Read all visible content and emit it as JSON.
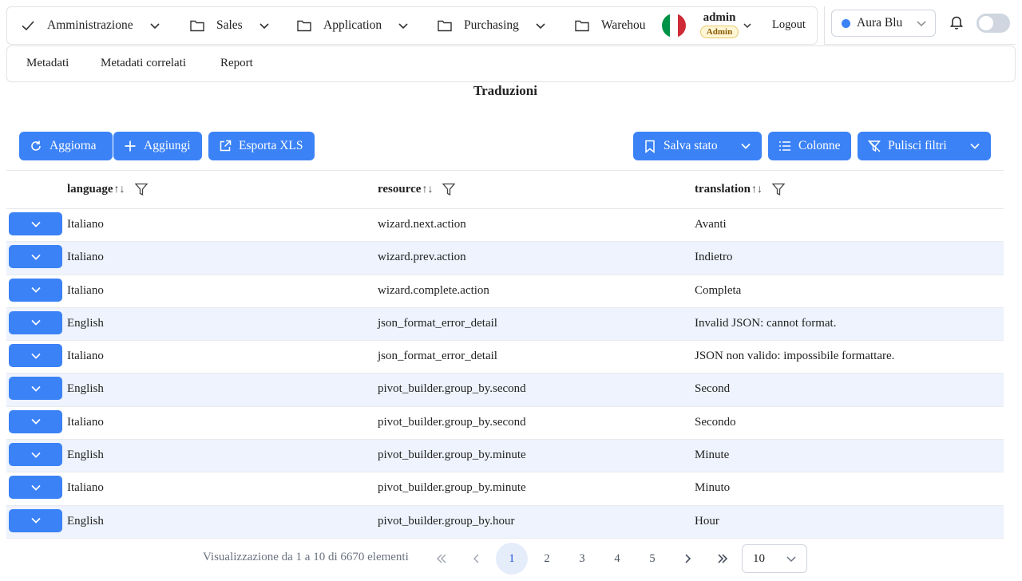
{
  "nav": {
    "items": [
      {
        "label": "Amministrazione",
        "icon": "check-icon"
      },
      {
        "label": "Sales",
        "icon": "folder-icon"
      },
      {
        "label": "Application",
        "icon": "folder-icon"
      },
      {
        "label": "Purchasing",
        "icon": "folder-icon"
      },
      {
        "label": "Warehou",
        "icon": "folder-icon"
      }
    ],
    "user_name": "admin",
    "user_role": "Admin",
    "logout_label": "Logout",
    "flag_colors": [
      "#009246",
      "#ffffff",
      "#ce2b37"
    ]
  },
  "theme": {
    "label": "Aura Blu",
    "dot_color": "#3b82f6"
  },
  "subnav": {
    "items": [
      "Metadati",
      "Metadati correlati",
      "Report"
    ]
  },
  "page_title": "Traduzioni",
  "toolbar": {
    "refresh_label": "Aggiorna",
    "add_label": "Aggiungi",
    "export_label": "Esporta XLS",
    "save_state_label": "Salva stato",
    "columns_label": "Colonne",
    "clear_filters_label": "Pulisci filtri"
  },
  "accent_color": "#3b82f6",
  "table": {
    "columns": [
      "language",
      "resource",
      "translation"
    ],
    "rows": [
      [
        "Italiano",
        "wizard.next.action",
        "Avanti"
      ],
      [
        "Italiano",
        "wizard.prev.action",
        "Indietro"
      ],
      [
        "Italiano",
        "wizard.complete.action",
        "Completa"
      ],
      [
        "English",
        "json_format_error_detail",
        "Invalid JSON: cannot format."
      ],
      [
        "Italiano",
        "json_format_error_detail",
        "JSON non valido: impossibile formattare."
      ],
      [
        "English",
        "pivot_builder.group_by.second",
        "Second"
      ],
      [
        "Italiano",
        "pivot_builder.group_by.second",
        "Secondo"
      ],
      [
        "English",
        "pivot_builder.group_by.minute",
        "Minute"
      ],
      [
        "Italiano",
        "pivot_builder.group_by.minute",
        "Minuto"
      ],
      [
        "English",
        "pivot_builder.group_by.hour",
        "Hour"
      ]
    ]
  },
  "pagination": {
    "info": "Visualizzazione da 1 a 10 di 6670 elementi",
    "pages": [
      "1",
      "2",
      "3",
      "4",
      "5"
    ],
    "current_page": "1",
    "page_size": "10"
  }
}
